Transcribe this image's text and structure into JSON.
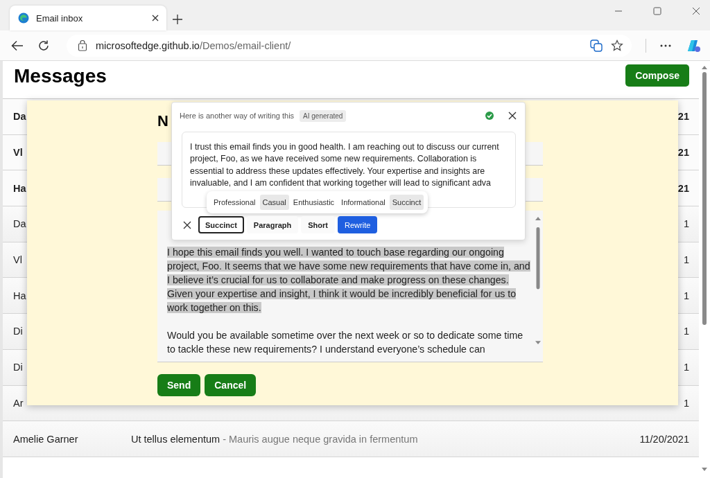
{
  "browser": {
    "tab": {
      "title": "Email inbox",
      "selected": true
    },
    "url_host": "microsoftedge.github.io",
    "url_path": "/Demos/email-client/"
  },
  "page": {
    "title": "Messages",
    "compose_button": "Compose"
  },
  "messages": [
    {
      "sender": "Da",
      "date": "21",
      "unread": true
    },
    {
      "sender": "Vl",
      "date": "21",
      "unread": true
    },
    {
      "sender": "Ha",
      "date": "21",
      "unread": true
    },
    {
      "sender": "Da",
      "date": "1",
      "unread": false
    },
    {
      "sender": "Vl",
      "date": "1",
      "unread": false
    },
    {
      "sender": "Ha",
      "date": "1",
      "unread": false
    },
    {
      "sender": "Di",
      "date": "1",
      "unread": false
    },
    {
      "sender": "Di",
      "date": "1",
      "unread": false
    },
    {
      "sender": "Ar",
      "date": "1",
      "unread": false
    },
    {
      "sender": "Amelie Garner",
      "subject": "Ut tellus elementum",
      "preview": "- Mauris augue neque gravida in fermentum",
      "date": "11/20/2021",
      "unread": false
    }
  ],
  "compose": {
    "heading": "N",
    "body": [
      {
        "text": "I hope this email finds you well. I wanted to touch base regarding our ongoing project, Foo. It seems that we have some new requirements that have come in, and I believe it’s crucial for us to collaborate and make progress on these changes. Given your expertise and insight, I think it would be incredibly beneficial for us to work together on this.",
        "selected": true
      },
      {
        "text": "Would you be available sometime over the next week or so to dedicate some time to tackle these new requirements? I understand everyone’s schedule can",
        "selected": false
      }
    ],
    "buttons": [
      "Send",
      "Cancel"
    ]
  },
  "rewrite": {
    "title": "Here is another way of writing this",
    "badge": "AI generated",
    "suggestion": "I trust this email finds you in good health. I am reaching out to discuss our current project, Foo, as we have received some new requirements. Collaboration is essential to address these updates effectively. Your expertise and insights are invaluable, and I am confident that working together will lead to significant adva",
    "tones": [
      {
        "label": "Professional",
        "selected": false
      },
      {
        "label": "Casual",
        "selected": true
      },
      {
        "label": "Enthusiastic",
        "selected": false
      },
      {
        "label": "Informational",
        "selected": false
      },
      {
        "label": "Succinct",
        "selected": true
      }
    ],
    "options": [
      {
        "label": "Succinct",
        "kind": "toggle",
        "selected": true
      },
      {
        "label": "Paragraph",
        "kind": "toggle",
        "selected": false
      },
      {
        "label": "Short",
        "kind": "toggle",
        "selected": false
      },
      {
        "label": "Rewrite",
        "kind": "primary"
      }
    ]
  }
}
